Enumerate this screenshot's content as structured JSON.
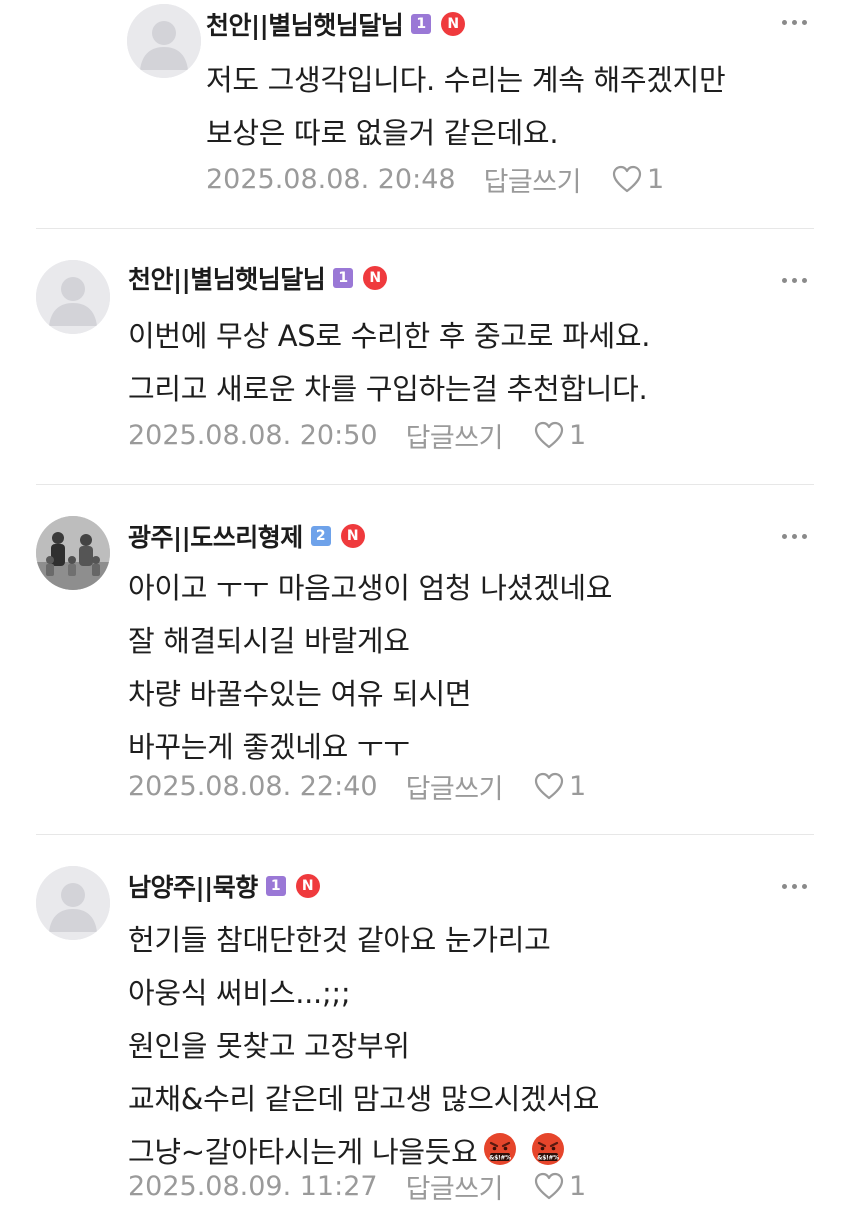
{
  "colors": {
    "level1": "#9a78d6",
    "level2": "#6ea2ea",
    "n_badge": "#ef3a3d",
    "meta_text": "#9a9a9a",
    "divider": "#e7e7e7"
  },
  "comments": [
    {
      "author": "천안||별님햇님달님",
      "level": "1",
      "n_badge": "N",
      "avatar": "default-avatar",
      "lines": [
        "저도 그생각입니다. 수리는 계속 해주겠지만",
        "보상은 따로 없을거 같은데요."
      ],
      "date": "2025.08.08. 20:48",
      "reply_label": "답글쓰기",
      "likes": "1"
    },
    {
      "author": "천안||별님햇님달님",
      "level": "1",
      "n_badge": "N",
      "avatar": "default-avatar",
      "lines": [
        "이번에 무상 AS로 수리한 후 중고로 파세요.",
        "그리고 새로운 차를 구입하는걸 추천합니다."
      ],
      "date": "2025.08.08. 20:50",
      "reply_label": "답글쓰기",
      "likes": "1"
    },
    {
      "author": "광주||도쓰리형제",
      "level": "2",
      "n_badge": "N",
      "avatar": "family-photo-avatar",
      "lines": [
        "아이고 ㅜㅜ 마음고생이 엄청 나셨겠네요",
        "잘 해결되시길 바랄게요",
        "차량 바꿀수있는 여유 되시면",
        "바꾸는게 좋겠네요 ㅜㅜ"
      ],
      "date": "2025.08.08. 22:40",
      "reply_label": "답글쓰기",
      "likes": "1"
    },
    {
      "author": "남양주||묵향",
      "level": "1",
      "n_badge": "N",
      "avatar": "default-avatar",
      "lines": [
        "헌기들 참대단한것 같아요 눈가리고",
        "아웅식 써비스...;;;",
        "원인을 못찾고 고장부위",
        "교채&수리 같은데 맘고생 많으시겠서요",
        "그냥~갈아타시는게 나을듯요"
      ],
      "emojis": [
        "angry-cursing-face-emoji",
        "angry-cursing-face-emoji"
      ],
      "date": "2025.08.09. 11:27",
      "reply_label": "답글쓰기",
      "likes": "1"
    }
  ]
}
